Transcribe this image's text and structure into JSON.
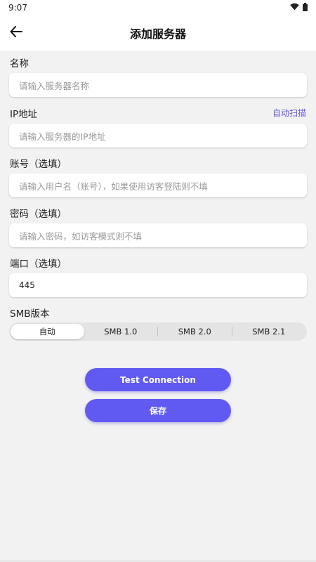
{
  "status_bar": {
    "time": "9:07"
  },
  "header": {
    "title": "添加服务器"
  },
  "form": {
    "name": {
      "label": "名称",
      "placeholder": "请输入服务器名称"
    },
    "ip": {
      "label": "IP地址",
      "action": "自动扫描",
      "placeholder": "请输入服务器的IP地址"
    },
    "account": {
      "label": "账号（选填）",
      "placeholder": "请输入用户名（账号），如果使用访客登陆则不填"
    },
    "password": {
      "label": "密码（选填）",
      "placeholder": "请输入密码，如访客模式则不填"
    },
    "port": {
      "label": "端口（选填）",
      "value": "445"
    },
    "smb": {
      "label": "SMB版本",
      "options": [
        "自动",
        "SMB 1.0",
        "SMB 2.0",
        "SMB 2.1"
      ],
      "selected": "自动"
    }
  },
  "actions": {
    "test_label": "Test Connection",
    "save_label": "保存"
  },
  "colors": {
    "accent": "#615af2",
    "link": "#5f56e8",
    "background": "#f2f2f2"
  },
  "icons": {
    "back": "arrow-left-icon",
    "wifi": "wifi-icon",
    "battery": "battery-icon"
  }
}
